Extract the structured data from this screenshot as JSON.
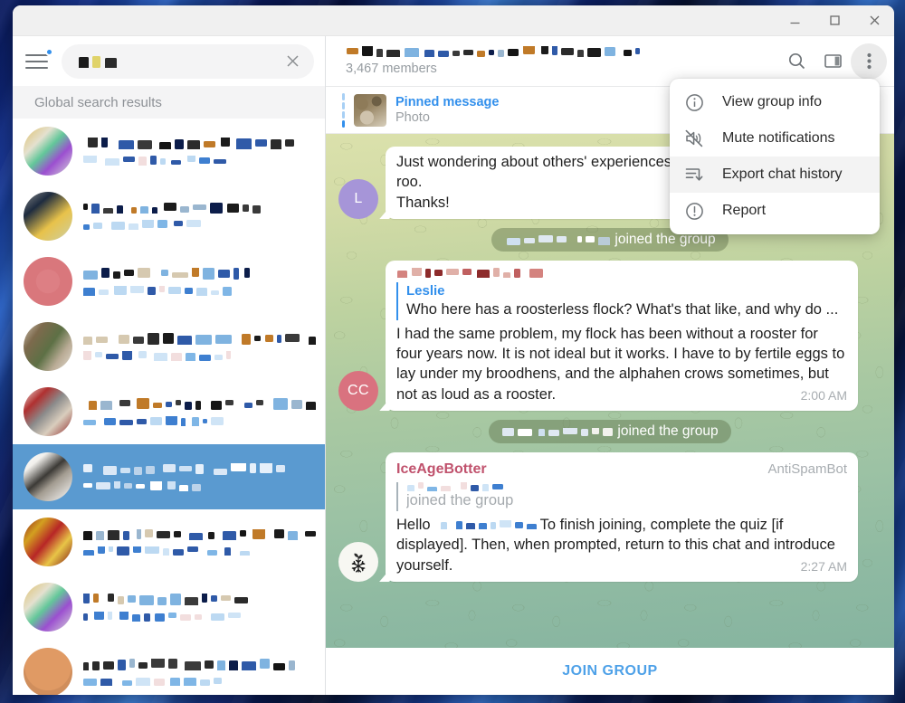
{
  "window": {
    "controls": {
      "minimize": "minimize-button",
      "maximize": "maximize-button",
      "close": "close-button"
    }
  },
  "sidebar": {
    "search": {
      "value_redacted": true,
      "clear_label": "clear-search"
    },
    "section_header": "Global search results",
    "menu_badge": true,
    "chats": [
      {
        "avatar": "linear-gradient(135deg,#dfc16a 0%,#e4e0cf 30%,#63c79a 48%,#9b4fd0 68%,#d8d8d8 100%)",
        "selected": false
      },
      {
        "avatar": "linear-gradient(140deg,#8b8b8b 0%,#1d2b3f 28%,#e8c24a 62%,#d9c97a 82%,#cfcfcf 100%)",
        "selected": false
      },
      {
        "avatar": "radial-gradient(circle at 50% 50%, #dd7f84 0 34%, #d9777c 35% 100%)",
        "selected": false
      },
      {
        "avatar": "linear-gradient(125deg,#cfc3b2 0%,#7d6a4d 25%,#5d7045 52%,#b9ab95 74%,#e4ded2 100%)",
        "selected": false
      },
      {
        "avatar": "linear-gradient(135deg,#efe9e3 0%,#b03030 26%,#8b8b8b 48%,#d9cdbd 70%,#8d2727 100%)",
        "selected": false
      },
      {
        "avatar": "linear-gradient(140deg,#ffffff 0%,#f2f0ec 22%,#3c3a36 46%,#a29b90 62%,#ffffff 100%)",
        "selected": true
      },
      {
        "avatar": "linear-gradient(130deg,#8f1b1b 0%,#d3a020 25%,#b72626 48%,#e8c547 70%,#7e1414 100%)",
        "selected": false
      },
      {
        "avatar": "linear-gradient(135deg,#dfc16a 0%,#e4e0cf 30%,#63c79a 48%,#9b4fd0 68%,#d8d8d8 100%)",
        "selected": false
      },
      {
        "avatar": "radial-gradient(circle at 50% 40%, #e09a64 0 60%, #d08e5c 61% 100%)",
        "selected": false
      }
    ]
  },
  "chat_header": {
    "title_redacted": true,
    "members": "3,467 members",
    "icons": [
      "search-icon",
      "sidebar-panel-icon",
      "more-options-icon"
    ]
  },
  "pinned": {
    "label": "Pinned message",
    "subtitle": "Photo"
  },
  "menu": {
    "items": [
      {
        "label": "View group info",
        "icon": "info-icon",
        "hover": false
      },
      {
        "label": "Mute notifications",
        "icon": "mute-icon",
        "hover": false
      },
      {
        "label": "Export chat history",
        "icon": "export-icon",
        "hover": true
      },
      {
        "label": "Report",
        "icon": "report-icon",
        "hover": false
      }
    ]
  },
  "messages": [
    {
      "type": "text",
      "avatar_initial": "L",
      "avatar_color": "#a695d8",
      "lines": [
        "Just wondering about others' experiences",
        "roo.",
        "Thanks!"
      ]
    },
    {
      "type": "service",
      "text": "joined the group",
      "name_redacted": true
    },
    {
      "type": "reply",
      "avatar_initial": "CC",
      "avatar_color": "#d9727f",
      "header_redacted": true,
      "reply_name": "Leslie",
      "reply_text": "Who here has a roosterless flock? What's that like, and why do ...",
      "body": "I had the same problem, my flock has been without a rooster for four years now. It is not ideal but it works. I have to by fertile eggs to lay under my broodhens, and the alphahen crows sometimes, but not as loud as a rooster.",
      "time": "2:00 AM"
    },
    {
      "type": "service",
      "text": "joined the group",
      "name_redacted": true
    },
    {
      "type": "bot",
      "avatar_icon": "sprout-snowflake-avatar",
      "name": "IceAgeBotter",
      "tag": "AntiSpamBot",
      "reply_name_redacted": true,
      "reply_text": "joined the group",
      "body": "Hello  To finish joining, complete the quiz [if displayed]. Then, when prompted, return to this chat and introduce yourself.",
      "body_prefix": "Hello",
      "body_rest": "To finish joining, complete the quiz [if displayed]. Then, when prompted, return to this chat and introduce yourself.",
      "time": "2:27 AM"
    }
  ],
  "join_bar": {
    "label": "JOIN GROUP"
  },
  "colors": {
    "accent_blue": "#3390ec",
    "link_blue": "#4ea1e8",
    "selected_row": "#5a9ad0",
    "bot_name": "#c0526d",
    "muted_text": "#a8adb1"
  }
}
